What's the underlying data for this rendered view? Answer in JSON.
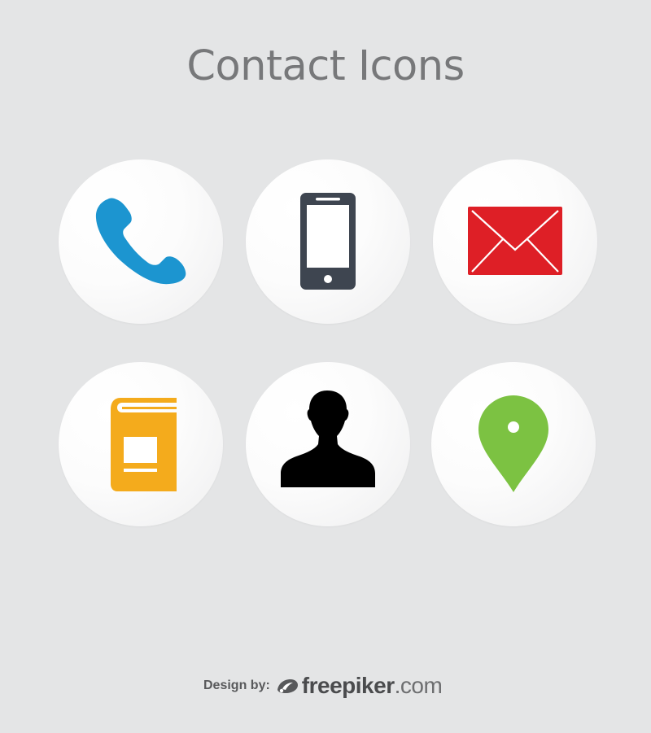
{
  "title": "Contact Icons",
  "icons": [
    {
      "name": "phone-icon",
      "color": "#1c95d0"
    },
    {
      "name": "smartphone-icon",
      "color": "#3e4550"
    },
    {
      "name": "envelope-icon",
      "color": "#de1f26"
    },
    {
      "name": "address-book-icon",
      "color": "#f4ab1c"
    },
    {
      "name": "person-icon",
      "color": "#000000"
    },
    {
      "name": "map-pin-icon",
      "color": "#7cc242"
    }
  ],
  "credit": {
    "label": "Design by:",
    "brand_bold": "freepiker",
    "brand_light": ".com"
  },
  "colors": {
    "background": "#e4e5e6",
    "title": "#77787a"
  }
}
